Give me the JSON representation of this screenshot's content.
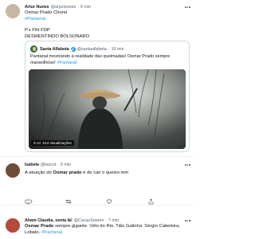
{
  "tweets": [
    {
      "name": "Artur Nunes",
      "handle": "@arjunnunes",
      "time": "6 min",
      "line1": "Osmar Prado Chorei",
      "hashtag": "#Pantanal",
      "line3": "P.s FIH FDP",
      "line4": "DESMENTINDO BOLSONARO",
      "quote": {
        "name": "Santa Alfabeta",
        "handle": "@santaalfabeta",
        "time": "16 min",
        "text": "Pantanal mostrando a realidade das queimadas! Osmar Prado sempre maravilhoso! ",
        "hashtag": "#Pantanal",
        "video_duration": "0:14",
        "video_views": "513 visualizações"
      },
      "colors": {
        "avatar": "#c6b7a6"
      }
    },
    {
      "name": "Isabela",
      "handle": "@isacut",
      "time": "6 min",
      "text_pre": "A atuação do ",
      "text_bold": "Osmar prado",
      "text_post": " é de cair o queixo mm",
      "colors": {
        "avatar": "#6e4c3a"
      }
    },
    {
      "name": "Aham Claudia, senta lá!",
      "handle": "@CacauSoares",
      "time": "7 min",
      "text_bold": "Osmar Prado",
      "text_post": " sempre gigante. Vélo do Rio. Tião Galinha. Sérgio Cabeleira, Lobato. ",
      "hashtag": "#Pantanal",
      "colors": {
        "avatar": "#b34a3c"
      }
    }
  ],
  "colors": {
    "link": "#1d9bf0",
    "secondary": "#536471",
    "border": "#cfd9de"
  },
  "icons": [
    "reply-icon",
    "retweet-icon",
    "like-icon",
    "share-icon",
    "more-icon",
    "verified-icon"
  ]
}
